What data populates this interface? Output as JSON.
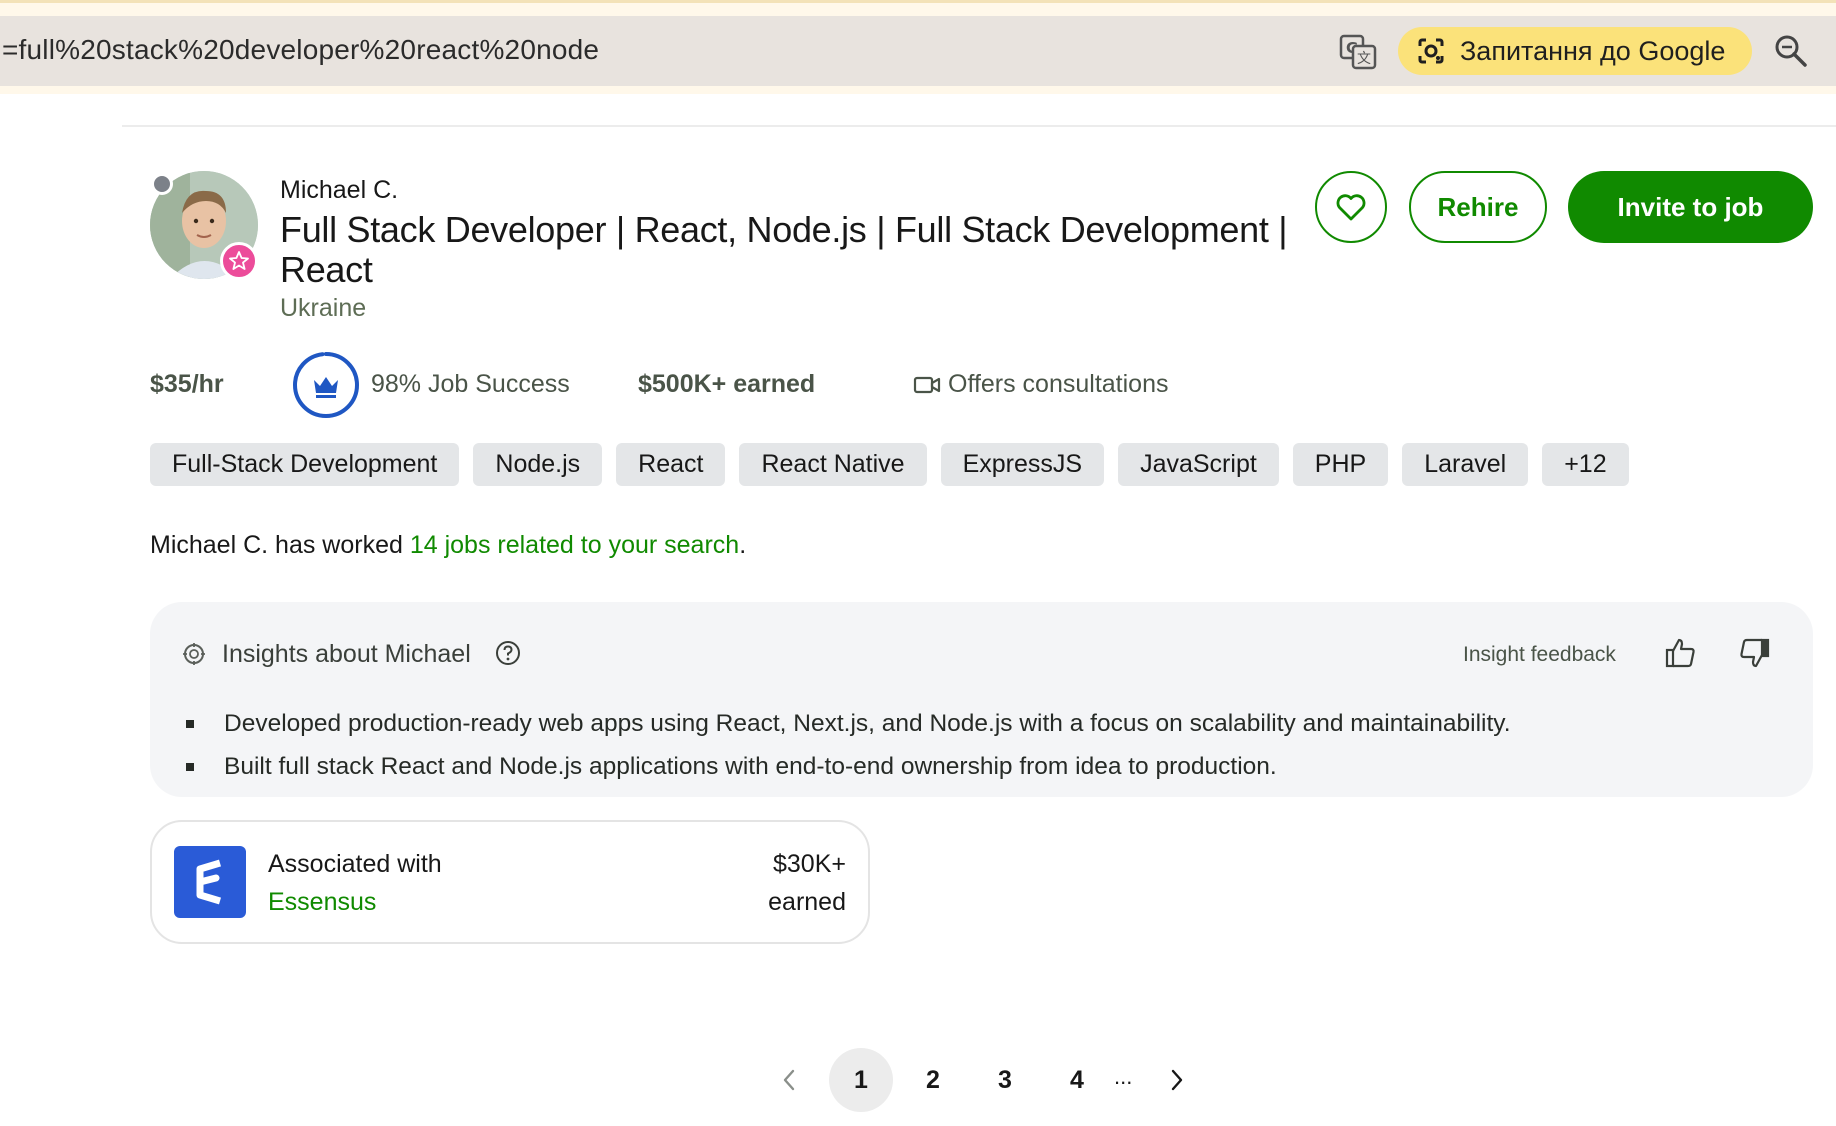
{
  "browser": {
    "url_fragment": "=full%20stack%20developer%20react%20node",
    "ask_google_label": "Запитання до Google"
  },
  "profile": {
    "name": "Michael C.",
    "title": "Full Stack Developer | React, Node.js | Full Stack Development | React",
    "location": "Ukraine",
    "rehire_label": "Rehire",
    "invite_label": "Invite to job",
    "hourly_rate": "$35/hr",
    "job_success": "98% Job Success",
    "job_success_value": 0.98,
    "earned": "$500K+ earned",
    "consultations": "Offers consultations",
    "skills": [
      "Full-Stack Development",
      "Node.js",
      "React",
      "React Native",
      "ExpressJS",
      "JavaScript",
      "PHP",
      "Laravel",
      "+12"
    ],
    "worked_prefix": "Michael C. has worked ",
    "worked_link": "14 jobs related to your search",
    "worked_suffix": "."
  },
  "insights": {
    "title": "Insights about Michael",
    "feedback_label": "Insight feedback",
    "items": [
      "Developed production-ready web apps using React, Next.js, and Node.js with a focus on scalability and maintainability.",
      "Built full stack React and Node.js applications with end-to-end ownership from idea to production."
    ]
  },
  "agency": {
    "associated_label": "Associated with",
    "name": "Essensus",
    "amount": "$30K+",
    "earned_label": "earned"
  },
  "pagination": {
    "pages": [
      "1",
      "2",
      "3",
      "4"
    ],
    "ellipsis": "...",
    "current": "1"
  },
  "colors": {
    "brand_green": "#108a00",
    "jss_blue": "#1f57c3",
    "badge_pink": "#ec4c9a",
    "agency_blue": "#2a5bd7"
  }
}
